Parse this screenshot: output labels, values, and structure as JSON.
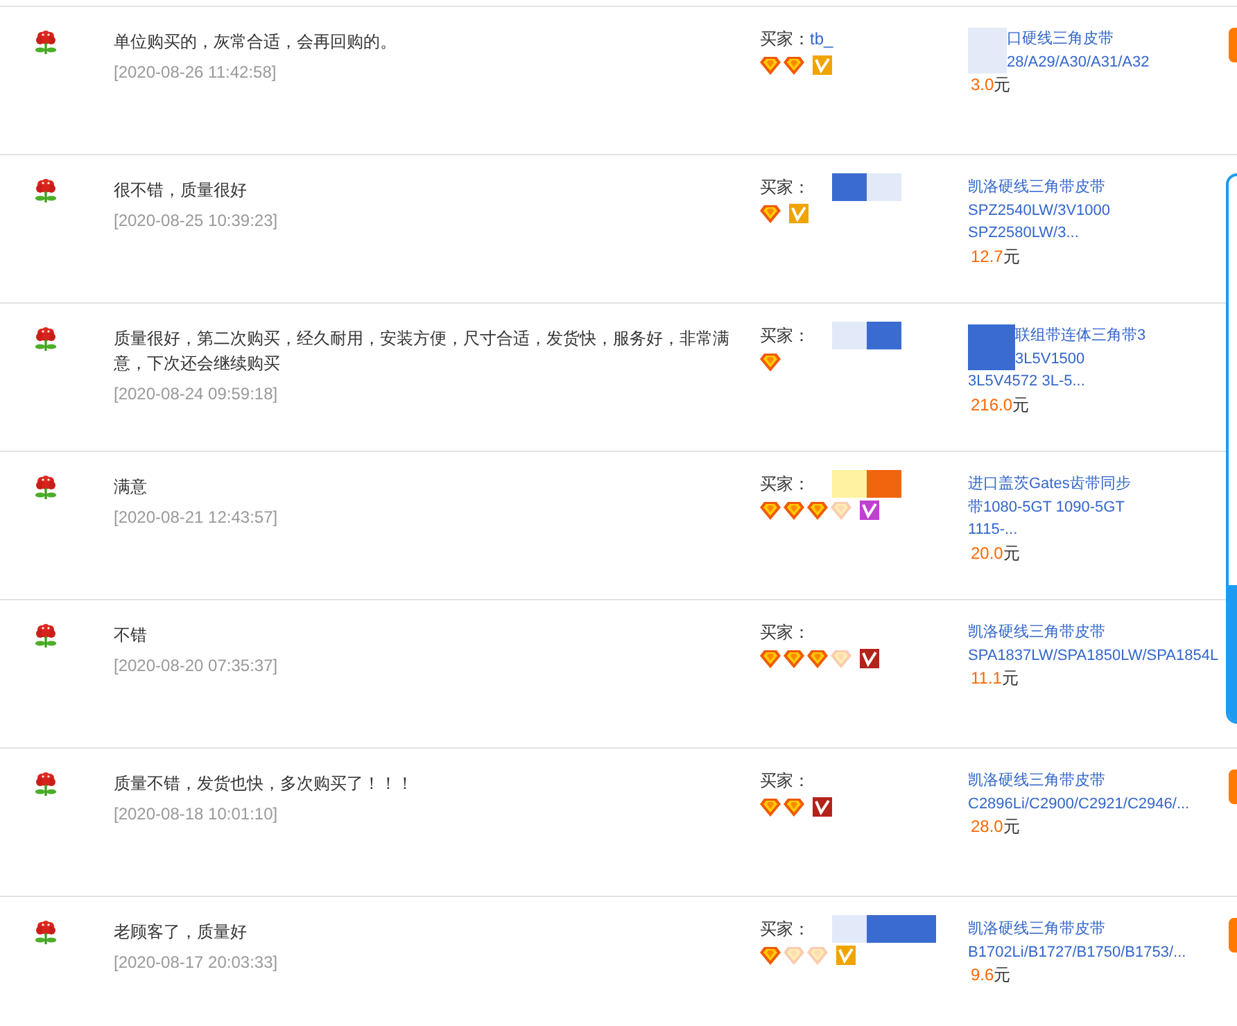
{
  "reviews": [
    {
      "comment": "单位购买的，灰常合适，会再回购的。",
      "date": "[2020-08-26 11:42:58]",
      "buyer": {
        "label": "买家：",
        "name": "tb_"
      },
      "diamonds": [
        {
          "faded": false
        },
        {
          "faded": false
        }
      ],
      "badge": {
        "color": "#f0a400"
      },
      "product": {
        "lines": [
          {
            "text": "口硬线三角皮带",
            "mask": {
              "kind": "faint"
            }
          },
          {
            "text": "28/A29/A30/A31/A32",
            "mask": {
              "kind": "faint"
            }
          }
        ]
      },
      "price": "3.0",
      "currency": "元",
      "action": {
        "kind": "button"
      }
    },
    {
      "comment": "很不错，质量很好",
      "date": "[2020-08-25 10:39:23]",
      "buyer": {
        "label": "买家：",
        "masks": [
          {
            "kind": "blue"
          },
          {
            "kind": "light"
          }
        ]
      },
      "diamonds": [
        {
          "faded": false
        }
      ],
      "badge": {
        "color": "#f0a400"
      },
      "product": {
        "lines": [
          {
            "text": "凯洛硬线三角带皮带"
          },
          {
            "text": "SPZ2540LW/3V1000"
          },
          {
            "text": "SPZ2580LW/3..."
          }
        ]
      },
      "price": "12.7",
      "currency": "元"
    },
    {
      "comment": "质量很好，第二次购买，经久耐用，安装方便，尺寸合适，发货快，服务好，非常满意，下次还会继续购买",
      "date": "[2020-08-24 09:59:18]",
      "buyer": {
        "label": "买家：",
        "masks": [
          {
            "kind": "light"
          },
          {
            "kind": "blue"
          }
        ]
      },
      "diamonds": [
        {
          "faded": false
        }
      ],
      "product": {
        "lines": [
          {
            "text": "联组带连体三角带3",
            "mask": {
              "kind": "blue"
            }
          },
          {
            "text": "3L5V1500",
            "mask": {
              "kind": "blue"
            }
          },
          {
            "text": "3L5V4572 3L-5..."
          }
        ]
      },
      "price": "216.0",
      "currency": "元"
    },
    {
      "comment": "满意",
      "date": "[2020-08-21 12:43:57]",
      "buyer": {
        "label": "买家：",
        "masks": [
          {
            "kind": "yellow"
          },
          {
            "kind": "orange"
          }
        ]
      },
      "diamonds": [
        {
          "faded": false
        },
        {
          "faded": false
        },
        {
          "faded": false
        },
        {
          "faded": true
        }
      ],
      "badge": {
        "color": "#c040d0"
      },
      "product": {
        "lines": [
          {
            "text": "进口盖茨Gates齿带同步"
          },
          {
            "text": "带1080-5GT 1090-5GT"
          },
          {
            "text": "1115-..."
          }
        ]
      },
      "price": "20.0",
      "currency": "元"
    },
    {
      "comment": "不错",
      "date": "[2020-08-20 07:35:37]",
      "buyer": {
        "label": "买家："
      },
      "diamonds": [
        {
          "faded": false
        },
        {
          "faded": false
        },
        {
          "faded": false
        },
        {
          "faded": true
        }
      ],
      "badge": {
        "color": "#b3231a"
      },
      "product": {
        "lines": [
          {
            "text": "凯洛硬线三角带皮带"
          },
          {
            "text": "SPA1837LW/SPA1850LW/SPA1854L"
          }
        ]
      },
      "price": "11.1",
      "currency": "元"
    },
    {
      "comment": "质量不错，发货也快，多次购买了！！！",
      "date": "[2020-08-18 10:01:10]",
      "buyer": {
        "label": "买家："
      },
      "diamonds": [
        {
          "faded": false
        },
        {
          "faded": false
        }
      ],
      "badge": {
        "color": "#b3231a"
      },
      "product": {
        "lines": [
          {
            "text": "凯洛硬线三角带皮带"
          },
          {
            "text": "C2896Li/C2900/C2921/C2946/..."
          }
        ]
      },
      "price": "28.0",
      "currency": "元",
      "action": {
        "kind": "button"
      }
    },
    {
      "comment": "老顾客了，质量好",
      "date": "[2020-08-17 20:03:33]",
      "buyer": {
        "label": "买家：",
        "masks": [
          {
            "kind": "light"
          },
          {
            "kind": "blue"
          },
          {
            "kind": "blue"
          }
        ]
      },
      "diamonds": [
        {
          "faded": false
        },
        {
          "faded": true
        },
        {
          "faded": true
        }
      ],
      "badge": {
        "color": "#f0a400"
      },
      "product": {
        "lines": [
          {
            "text": "凯洛硬线三角带皮带"
          },
          {
            "text": "B1702Li/B1727/B1750/B1753/..."
          }
        ]
      },
      "price": "9.6",
      "currency": "元",
      "action": {
        "kind": "button"
      }
    }
  ]
}
